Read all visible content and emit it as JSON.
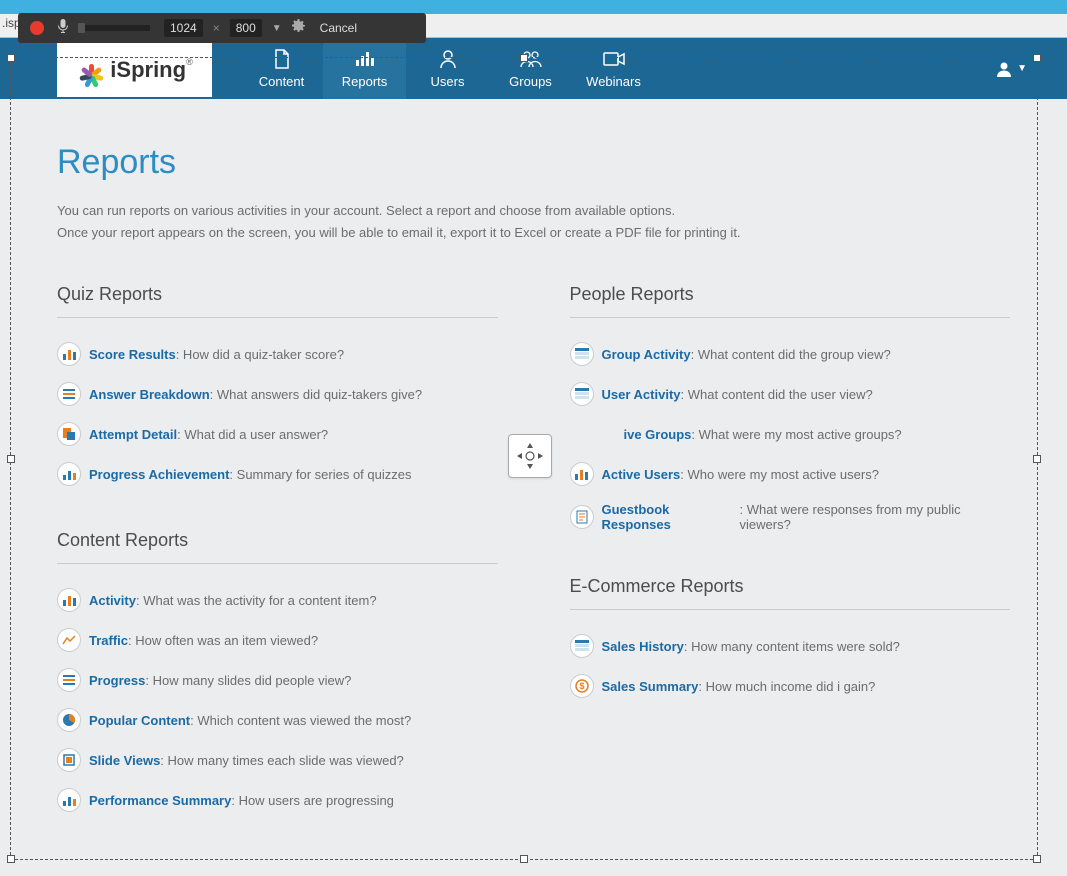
{
  "url_fragment": ".isp",
  "recorder": {
    "width": "1024",
    "height": "800",
    "cancel": "Cancel"
  },
  "logo": "iSpring",
  "nav": [
    {
      "label": "Content"
    },
    {
      "label": "Reports"
    },
    {
      "label": "Users"
    },
    {
      "label": "Groups"
    },
    {
      "label": "Webinars"
    }
  ],
  "page": {
    "title": "Reports",
    "intro1": "You can run reports on various activities in your account. Select a report and choose from available options.",
    "intro2": "Once your report appears on the screen, you will be able to email it, export it to Excel or create a PDF file for printing it."
  },
  "sections": {
    "quiz": {
      "title": "Quiz Reports",
      "items": [
        {
          "name": "Score Results",
          "desc": ": How did a quiz-taker score?"
        },
        {
          "name": "Answer Breakdown",
          "desc": ": What answers did quiz-takers give?"
        },
        {
          "name": "Attempt Detail",
          "desc": ": What did a user answer?"
        },
        {
          "name": "Progress Achievement",
          "desc": ": Summary for series of quizzes"
        }
      ]
    },
    "content": {
      "title": "Content Reports",
      "items": [
        {
          "name": "Activity",
          "desc": ": What was the activity for a content item?"
        },
        {
          "name": "Traffic",
          "desc": ": How often was an item viewed?"
        },
        {
          "name": "Progress",
          "desc": ": How many slides did people view?"
        },
        {
          "name": "Popular Content",
          "desc": ": Which content was viewed the most?"
        },
        {
          "name": "Slide Views",
          "desc": ": How many times each slide was viewed?"
        },
        {
          "name": "Performance Summary",
          "desc": ": How users are progressing"
        }
      ]
    },
    "people": {
      "title": "People Reports",
      "items": [
        {
          "name": "Group Activity",
          "desc": ": What content did the group view?"
        },
        {
          "name": "User Activity",
          "desc": ": What content did the user view?"
        },
        {
          "name": "ive Groups",
          "desc": ": What were my most active groups?"
        },
        {
          "name": "Active Users",
          "desc": ": Who were my most active users?"
        },
        {
          "name": "Guestbook Responses",
          "desc": ": What were responses from my public viewers?"
        }
      ]
    },
    "ecom": {
      "title": "E-Commerce Reports",
      "items": [
        {
          "name": "Sales History",
          "desc": ": How many content items were sold?"
        },
        {
          "name": "Sales Summary",
          "desc": ": How much income did i gain?"
        }
      ]
    }
  }
}
